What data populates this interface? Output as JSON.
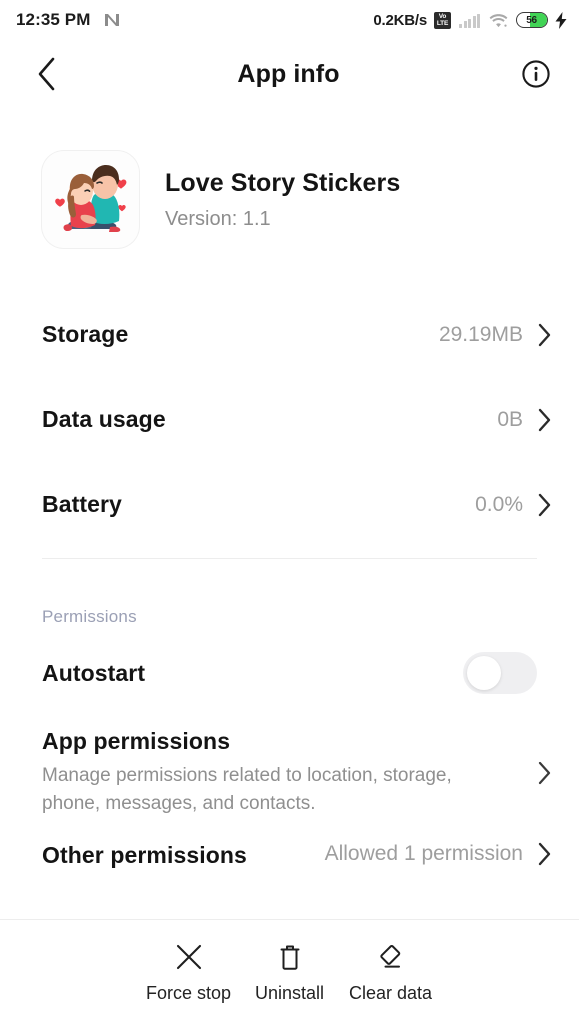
{
  "status_bar": {
    "time": "12:35 PM",
    "nfc_icon": "nfc-n-icon",
    "net_speed": "0.2KB/s",
    "volte_top": "Vo",
    "volte_bottom": "LTE",
    "signal_icon": "signal-bars-icon",
    "wifi_icon": "wifi-icon",
    "battery_level": "56",
    "battery_percent": 56,
    "battery_color": "#41d455",
    "charging_icon": "charging-bolt-icon"
  },
  "header": {
    "back_icon": "back-chevron-icon",
    "title": "App info",
    "info_icon": "info-circle-icon"
  },
  "app": {
    "icon_name": "love-story-stickers-app-icon",
    "name": "Love Story Stickers",
    "version": "Version: 1.1"
  },
  "rows": [
    {
      "label": "Storage",
      "value": "29.19MB"
    },
    {
      "label": "Data usage",
      "value": "0B"
    },
    {
      "label": "Battery",
      "value": "0.0%"
    }
  ],
  "permissions": {
    "section_title": "Permissions",
    "autostart": {
      "label": "Autostart",
      "enabled": false
    },
    "app_permissions": {
      "title": "App permissions",
      "subtitle": "Manage permissions related to location, storage, phone, messages, and contacts."
    },
    "other_permissions": {
      "title": "Other permissions",
      "value": "Allowed 1 permission"
    }
  },
  "bottom_actions": [
    {
      "label": "Force stop",
      "icon": "close-x-icon"
    },
    {
      "label": "Uninstall",
      "icon": "trash-icon"
    },
    {
      "label": "Clear data",
      "icon": "eraser-icon"
    }
  ]
}
